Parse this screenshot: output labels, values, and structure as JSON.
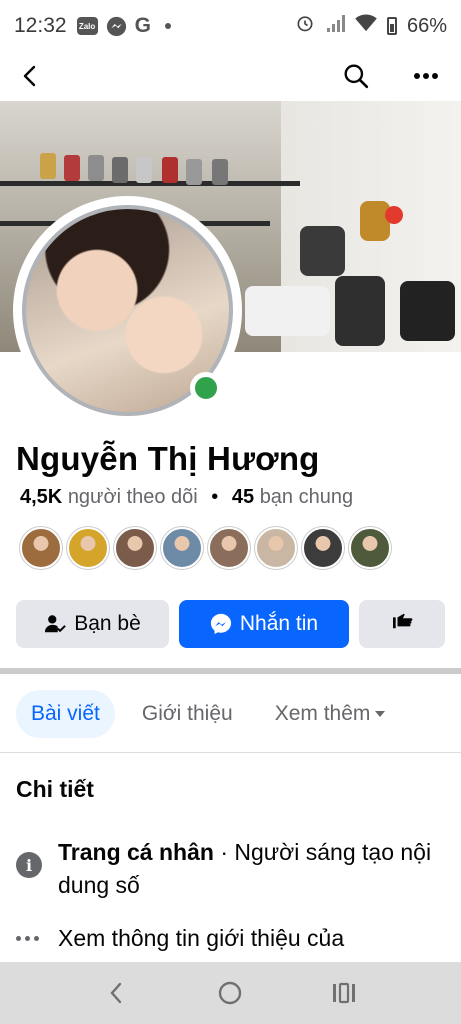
{
  "status_bar": {
    "time": "12:32",
    "zalo_label": "Zalo",
    "battery": "66%"
  },
  "profile": {
    "name": "Nguyễn Thị Hương",
    "followers_count": "4,5K",
    "followers_label": "người theo dõi",
    "separator": "•",
    "mutual_count": "45",
    "mutual_label": "bạn chung"
  },
  "mutual_friends_colors": [
    "#9c6b3e",
    "#d4a52a",
    "#7b5c4a",
    "#6d8aa6",
    "#8a6d5a",
    "#c9b6a3",
    "#3c3c3c",
    "#4f5a3c"
  ],
  "actions": {
    "friends_label": "Bạn bè",
    "message_label": "Nhắn tin"
  },
  "tabs": [
    {
      "label": "Bài viết"
    },
    {
      "label": "Giới thiệu"
    },
    {
      "label": "Xem thêm"
    }
  ],
  "details": {
    "title": "Chi tiết",
    "row1_bold": "Trang cá nhân",
    "row1_rest": " · Người sáng tạo nội dung số",
    "row2": "Xem thông tin giới thiệu của"
  },
  "colors": {
    "accent": "#0866ff",
    "online": "#31a24c",
    "secondary_text": "#65676b"
  }
}
